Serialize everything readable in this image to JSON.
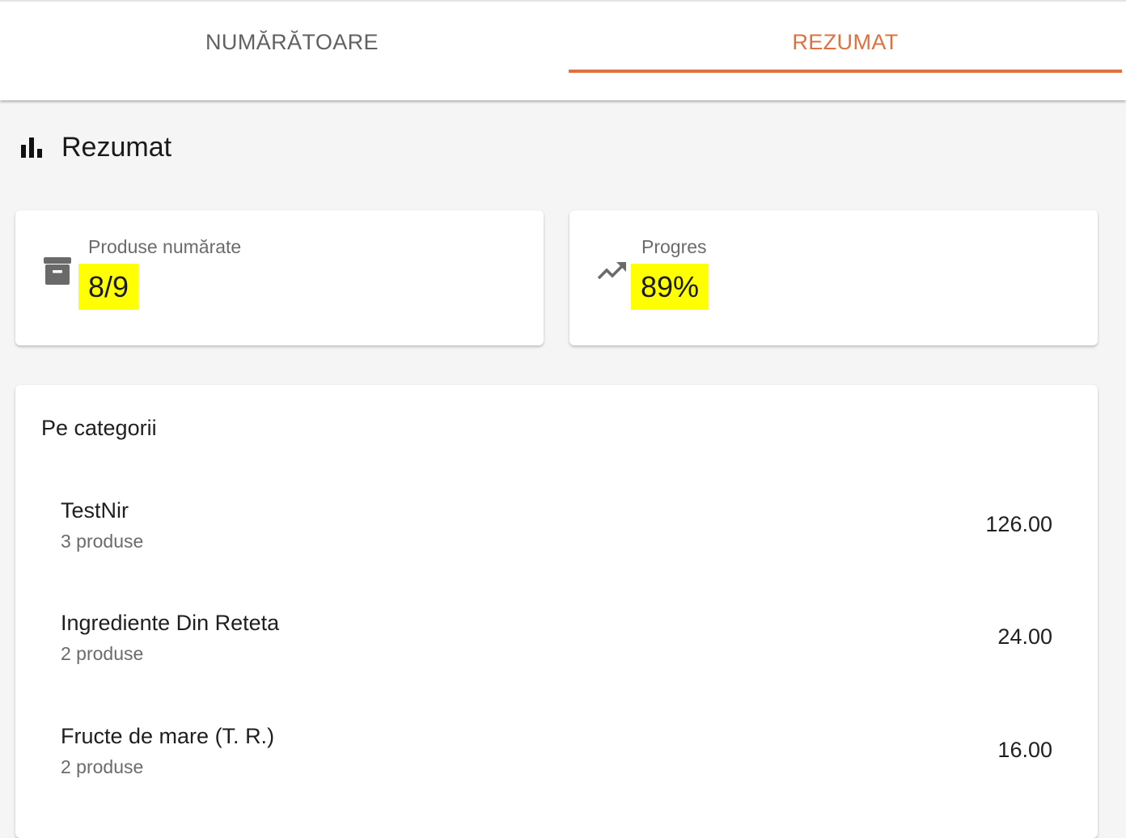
{
  "tabs": [
    {
      "label": "NUMĂRĂTOARE",
      "active": false
    },
    {
      "label": "REZUMAT",
      "active": true
    }
  ],
  "accent_color": "#e0703f",
  "summary": {
    "title": "Rezumat",
    "icon": "bar-chart-icon"
  },
  "stats": [
    {
      "label": "Produse numărate",
      "value": "8/9",
      "icon": "archive-box-icon"
    },
    {
      "label": "Progres",
      "value": "89%",
      "icon": "trending-up-icon"
    }
  ],
  "categories": {
    "title": "Pe categorii",
    "rows": [
      {
        "name": "TestNir",
        "count": "3 produse",
        "total": "126.00"
      },
      {
        "name": "Ingrediente Din Reteta",
        "count": "2 produse",
        "total": "24.00"
      },
      {
        "name": "Fructe de mare (T. R.)",
        "count": "2 produse",
        "total": "16.00"
      }
    ]
  }
}
